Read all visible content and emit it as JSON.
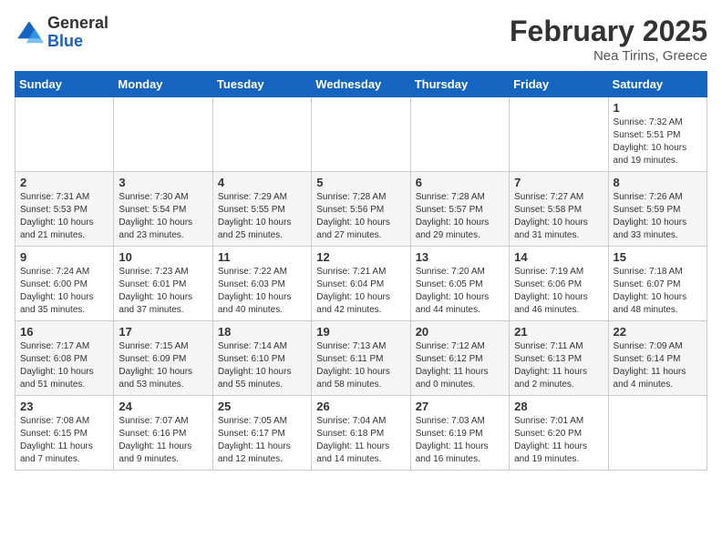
{
  "header": {
    "logo": {
      "line1": "General",
      "line2": "Blue"
    },
    "title": "February 2025",
    "subtitle": "Nea Tirins, Greece"
  },
  "weekdays": [
    "Sunday",
    "Monday",
    "Tuesday",
    "Wednesday",
    "Thursday",
    "Friday",
    "Saturday"
  ],
  "weeks": [
    [
      null,
      null,
      null,
      null,
      null,
      null,
      {
        "day": 1,
        "sunrise": "7:32 AM",
        "sunset": "5:51 PM",
        "daylight": "10 hours and 19 minutes."
      }
    ],
    [
      {
        "day": 2,
        "sunrise": "7:31 AM",
        "sunset": "5:53 PM",
        "daylight": "10 hours and 21 minutes."
      },
      {
        "day": 3,
        "sunrise": "7:30 AM",
        "sunset": "5:54 PM",
        "daylight": "10 hours and 23 minutes."
      },
      {
        "day": 4,
        "sunrise": "7:29 AM",
        "sunset": "5:55 PM",
        "daylight": "10 hours and 25 minutes."
      },
      {
        "day": 5,
        "sunrise": "7:28 AM",
        "sunset": "5:56 PM",
        "daylight": "10 hours and 27 minutes."
      },
      {
        "day": 6,
        "sunrise": "7:28 AM",
        "sunset": "5:57 PM",
        "daylight": "10 hours and 29 minutes."
      },
      {
        "day": 7,
        "sunrise": "7:27 AM",
        "sunset": "5:58 PM",
        "daylight": "10 hours and 31 minutes."
      },
      {
        "day": 8,
        "sunrise": "7:26 AM",
        "sunset": "5:59 PM",
        "daylight": "10 hours and 33 minutes."
      }
    ],
    [
      {
        "day": 9,
        "sunrise": "7:24 AM",
        "sunset": "6:00 PM",
        "daylight": "10 hours and 35 minutes."
      },
      {
        "day": 10,
        "sunrise": "7:23 AM",
        "sunset": "6:01 PM",
        "daylight": "10 hours and 37 minutes."
      },
      {
        "day": 11,
        "sunrise": "7:22 AM",
        "sunset": "6:03 PM",
        "daylight": "10 hours and 40 minutes."
      },
      {
        "day": 12,
        "sunrise": "7:21 AM",
        "sunset": "6:04 PM",
        "daylight": "10 hours and 42 minutes."
      },
      {
        "day": 13,
        "sunrise": "7:20 AM",
        "sunset": "6:05 PM",
        "daylight": "10 hours and 44 minutes."
      },
      {
        "day": 14,
        "sunrise": "7:19 AM",
        "sunset": "6:06 PM",
        "daylight": "10 hours and 46 minutes."
      },
      {
        "day": 15,
        "sunrise": "7:18 AM",
        "sunset": "6:07 PM",
        "daylight": "10 hours and 48 minutes."
      }
    ],
    [
      {
        "day": 16,
        "sunrise": "7:17 AM",
        "sunset": "6:08 PM",
        "daylight": "10 hours and 51 minutes."
      },
      {
        "day": 17,
        "sunrise": "7:15 AM",
        "sunset": "6:09 PM",
        "daylight": "10 hours and 53 minutes."
      },
      {
        "day": 18,
        "sunrise": "7:14 AM",
        "sunset": "6:10 PM",
        "daylight": "10 hours and 55 minutes."
      },
      {
        "day": 19,
        "sunrise": "7:13 AM",
        "sunset": "6:11 PM",
        "daylight": "10 hours and 58 minutes."
      },
      {
        "day": 20,
        "sunrise": "7:12 AM",
        "sunset": "6:12 PM",
        "daylight": "11 hours and 0 minutes."
      },
      {
        "day": 21,
        "sunrise": "7:11 AM",
        "sunset": "6:13 PM",
        "daylight": "11 hours and 2 minutes."
      },
      {
        "day": 22,
        "sunrise": "7:09 AM",
        "sunset": "6:14 PM",
        "daylight": "11 hours and 4 minutes."
      }
    ],
    [
      {
        "day": 23,
        "sunrise": "7:08 AM",
        "sunset": "6:15 PM",
        "daylight": "11 hours and 7 minutes."
      },
      {
        "day": 24,
        "sunrise": "7:07 AM",
        "sunset": "6:16 PM",
        "daylight": "11 hours and 9 minutes."
      },
      {
        "day": 25,
        "sunrise": "7:05 AM",
        "sunset": "6:17 PM",
        "daylight": "11 hours and 12 minutes."
      },
      {
        "day": 26,
        "sunrise": "7:04 AM",
        "sunset": "6:18 PM",
        "daylight": "11 hours and 14 minutes."
      },
      {
        "day": 27,
        "sunrise": "7:03 AM",
        "sunset": "6:19 PM",
        "daylight": "11 hours and 16 minutes."
      },
      {
        "day": 28,
        "sunrise": "7:01 AM",
        "sunset": "6:20 PM",
        "daylight": "11 hours and 19 minutes."
      },
      null
    ]
  ],
  "labels": {
    "sunrise": "Sunrise:",
    "sunset": "Sunset:",
    "daylight": "Daylight:"
  }
}
